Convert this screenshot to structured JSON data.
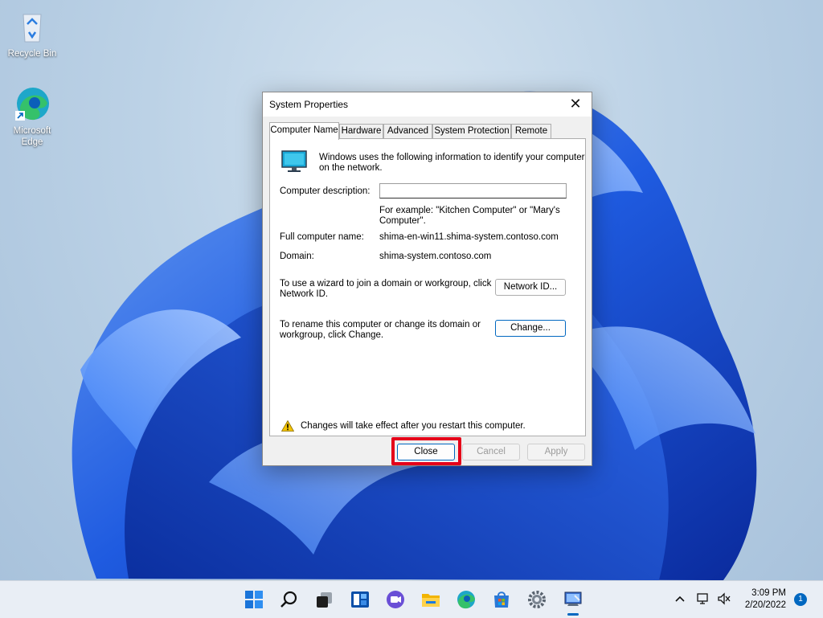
{
  "desktop": {
    "icons": [
      {
        "label": "Recycle Bin",
        "icon": "recycle-bin-icon"
      },
      {
        "label": "Microsoft Edge",
        "icon": "edge-icon"
      }
    ]
  },
  "dialog": {
    "title": "System Properties",
    "close_glyph": "✕",
    "tabs": [
      {
        "label": "Computer Name",
        "active": true
      },
      {
        "label": "Hardware"
      },
      {
        "label": "Advanced"
      },
      {
        "label": "System Protection"
      },
      {
        "label": "Remote"
      }
    ],
    "intro_line1": "Windows uses the following information to identify your computer",
    "intro_line2": "on the network.",
    "computer_description_label": "Computer description:",
    "computer_description_value": "",
    "example_line1": "For example: \"Kitchen Computer\" or \"Mary's",
    "example_line2": "Computer\".",
    "full_name_label": "Full computer name:",
    "full_name_value": "shima-en-win11.shima-system.contoso.com",
    "domain_label": "Domain:",
    "domain_value": "shima-system.contoso.com",
    "network_text_line1": "To use a wizard to join a domain or workgroup, click",
    "network_text_line2": "Network ID.",
    "network_button": "Network ID...",
    "rename_text_line1": "To rename this computer or change its domain or",
    "rename_text_line2": "workgroup, click Change.",
    "change_button": "Change...",
    "warning_text": "Changes will take effect after you restart this computer.",
    "buttons": {
      "close": "Close",
      "cancel": "Cancel",
      "apply": "Apply"
    }
  },
  "taskbar": {
    "apps": [
      "start-icon",
      "search-icon",
      "task-view-icon",
      "widgets-icon",
      "chat-icon",
      "file-explorer-icon",
      "edge-icon",
      "store-icon",
      "settings-icon",
      "system-properties-icon"
    ],
    "tray": {
      "chevron": "^"
    },
    "clock_time": "3:09 PM",
    "clock_date": "2/20/2022",
    "notification_count": "1"
  },
  "colors": {
    "accent": "#0067c0",
    "highlight": "#e5001a"
  }
}
